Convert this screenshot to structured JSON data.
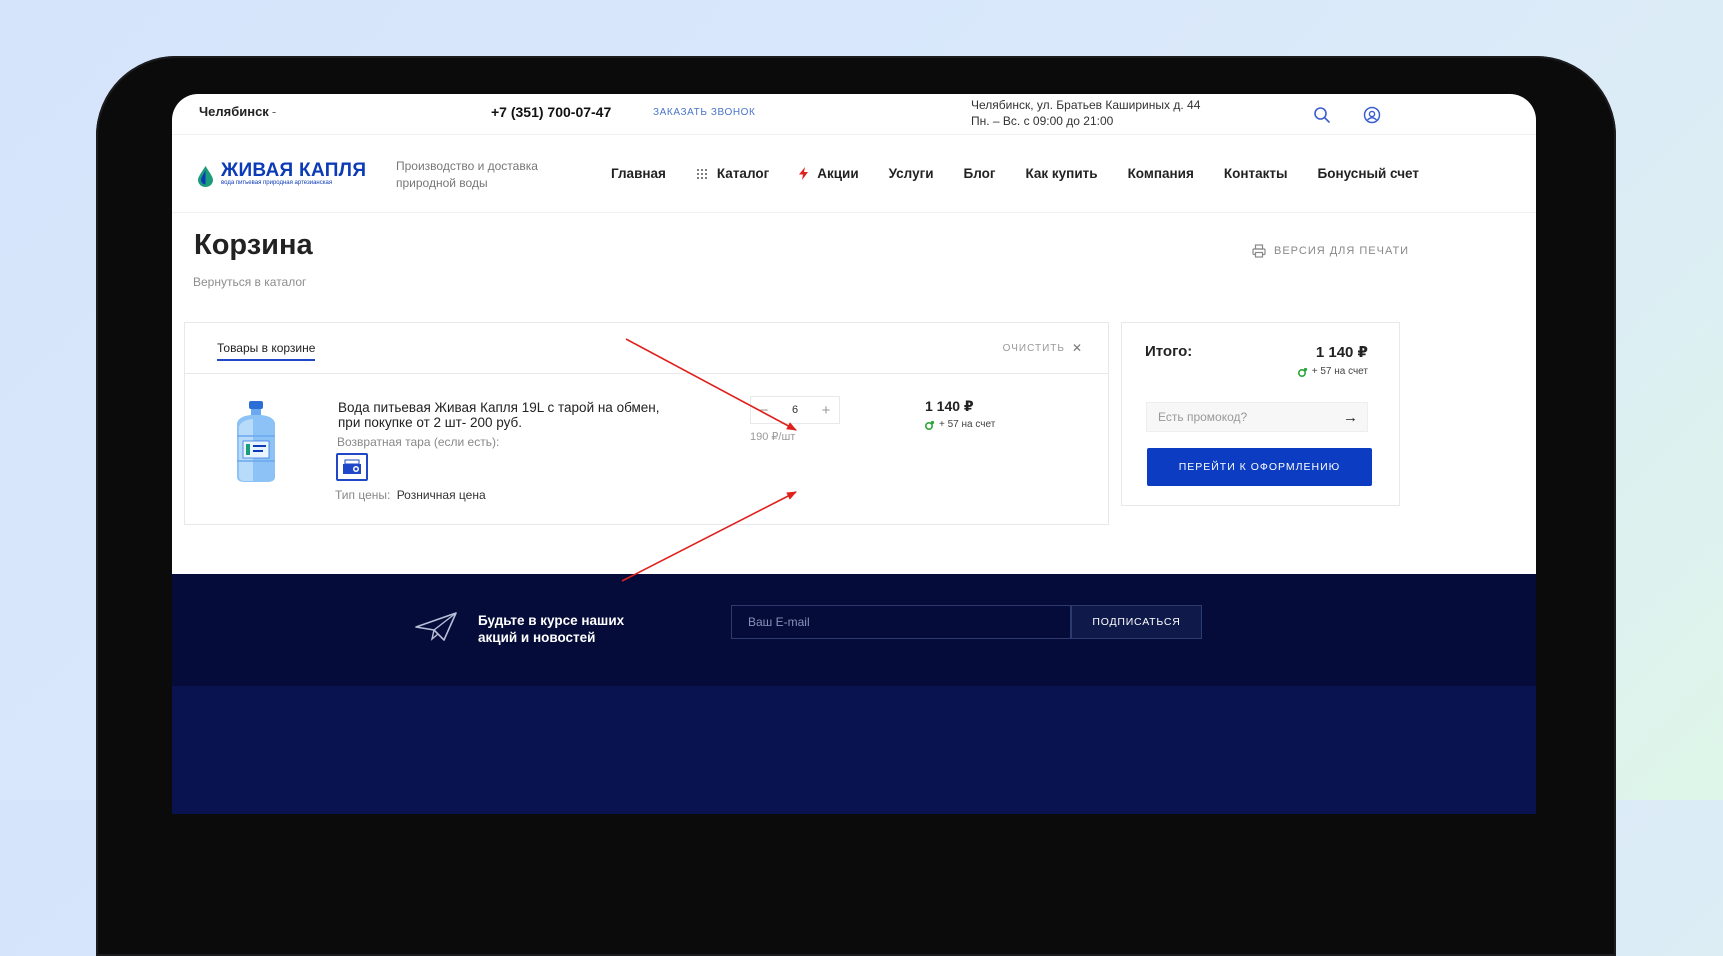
{
  "topbar": {
    "city": "Челябинск",
    "phone": "+7 (351) 700-07-47",
    "callback": "ЗАКАЗАТЬ ЗВОНОК",
    "address_line1": "Челябинск, ул. Братьев Кашириных д. 44",
    "address_line2": "Пн. – Вс. с 09:00 до 21:00"
  },
  "header": {
    "logo_title": "ЖИВАЯ КАПЛЯ",
    "logo_subtitle": "вода питьевая природная артезианская",
    "tagline": "Производство и доставка природной воды",
    "nav": [
      {
        "label": "Главная"
      },
      {
        "label": "Каталог",
        "icon": "grid-icon"
      },
      {
        "label": "Акции",
        "icon": "lightning-icon"
      },
      {
        "label": "Услуги"
      },
      {
        "label": "Блог"
      },
      {
        "label": "Как купить"
      },
      {
        "label": "Компания"
      },
      {
        "label": "Контакты"
      },
      {
        "label": "Бонусный счет"
      }
    ]
  },
  "page": {
    "title": "Корзина",
    "back_link": "Вернуться в каталог",
    "print_label": "ВЕРСИЯ ДЛЯ ПЕЧАТИ"
  },
  "cart": {
    "tab_label": "Товары в корзине",
    "clear_label": "ОЧИСТИТЬ",
    "item": {
      "name": "Вода питьевая Живая Капля 19L с тарой на обмен, при покупке от 2 шт- 200 руб.",
      "tara_label": "Возвратная тара (если есть):",
      "price_type_label": "Тип цены:",
      "price_type_value": "Розничная цена",
      "quantity": "6",
      "unit_price": "190 ₽/шт",
      "sum": "1 140 ₽",
      "bonus": "+ 57 на счет"
    }
  },
  "summary": {
    "total_label": "Итого:",
    "total_value": "1 140 ₽",
    "bonus": "+ 57 на счет",
    "promo_placeholder": "Есть промокод?",
    "checkout_label": "ПЕРЕЙТИ К ОФОРМЛЕНИЮ"
  },
  "footer": {
    "subscribe_text_line1": "Будьте в курсе наших",
    "subscribe_text_line2": "акций и новостей",
    "email_placeholder": "Ваш E-mail",
    "subscribe_button": "ПОДПИСАТЬСЯ"
  },
  "colors": {
    "brand_blue": "#0b3cc1",
    "footer_navy": "#050c3a",
    "annotation_red": "#e0201c"
  }
}
